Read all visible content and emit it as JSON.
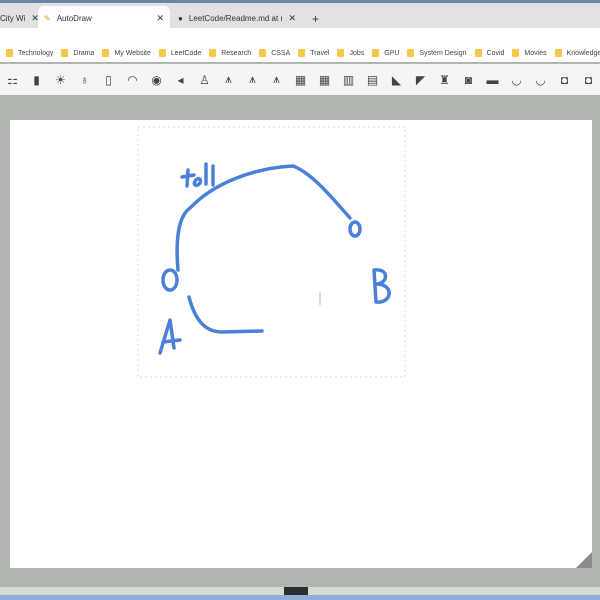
{
  "tabs": [
    {
      "label": "City Wi",
      "close": "✕"
    },
    {
      "label": "AutoDraw",
      "close": "✕"
    },
    {
      "label": "LeetCode/Readme.md at maste",
      "close": "✕"
    }
  ],
  "new_tab": "+",
  "bookmarks": [
    "Technology",
    "Drama",
    "My Website",
    "LeetCode",
    "Research",
    "CSSA",
    "Travel",
    "Jobs",
    "GPU",
    "System Design",
    "Covid",
    "Movies",
    "Knowledge"
  ],
  "suggestion_icons": [
    "traffic-light",
    "lamp",
    "bulb-on",
    "bulb",
    "cfl-bulb",
    "wifi",
    "eye",
    "speaker",
    "statue",
    "eiffel-1",
    "eiffel-2",
    "eiffel-3",
    "building-1",
    "building-2",
    "kiosk",
    "buildings",
    "bulldozer",
    "excavator",
    "robot",
    "tractor",
    "race-car",
    "car-outline",
    "car-2",
    "car-3",
    "car-4"
  ],
  "drawing": {
    "stroke_color": "#4b80d8",
    "labels": {
      "top": "toll",
      "a": "A",
      "b": "B"
    }
  }
}
